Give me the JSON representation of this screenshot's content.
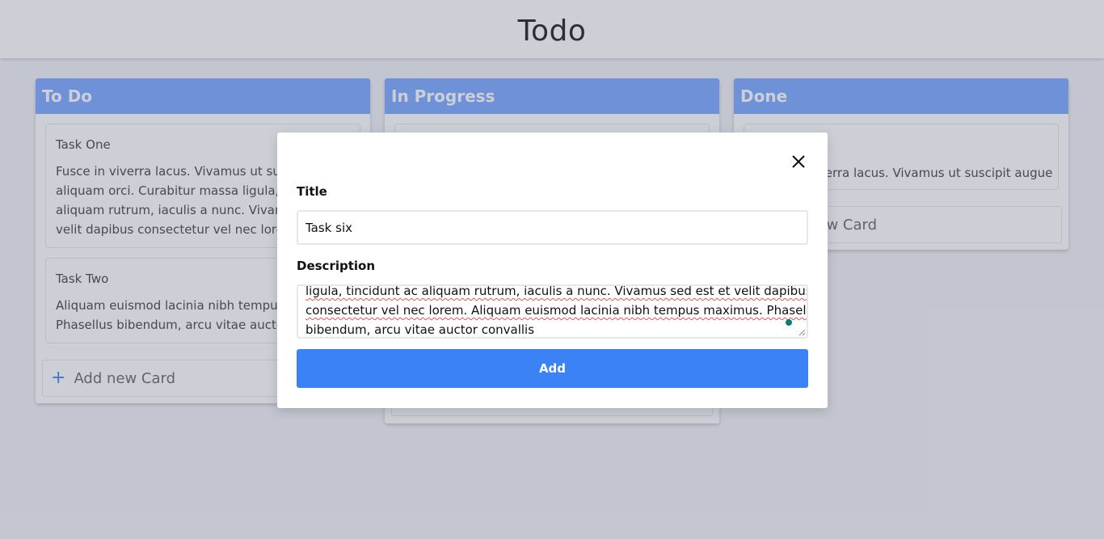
{
  "app": {
    "title": "Todo"
  },
  "columns": [
    {
      "title": "To Do",
      "cards": [
        {
          "title": "Task One",
          "lines": [
            "Fusce in viverra lacus. Vivamus ut suscipit augue",
            "aliquam orci. Curabitur massa ligula, tincidunt ac",
            "aliquam rutrum, iaculis a nunc. Vivamus sed est et",
            "velit dapibus consectetur vel nec lorem"
          ]
        },
        {
          "title": "Task Two",
          "lines": [
            "Aliquam euismod lacinia nibh tempus maximus.",
            "Phasellus bibendum, arcu vitae auctor convallis"
          ]
        }
      ],
      "add_label": "Add new Card"
    },
    {
      "title": "In Progress"
    },
    {
      "title": "Done",
      "cards": [
        {
          "lines": [
            "Fusce in viverra lacus. Vivamus ut suscipit augue"
          ]
        }
      ],
      "add_label": "Add new Card"
    }
  ],
  "modal": {
    "title_label": "Title",
    "title_value": "Task six",
    "description_label": "Description",
    "description_lines": [
      "ligula, tincidunt ac aliquam rutrum, iaculis a nunc. Vivamus sed est et velit dapibus",
      "consectetur vel nec lorem. Aliquam euismod lacinia nibh tempus maximus. Phasellus",
      "bibendum, arcu vitae auctor convallis"
    ],
    "add_button": "Add"
  },
  "icons": {
    "close": "close-icon",
    "plus": "plus-icon"
  },
  "colors": {
    "column_header": "#87b0ff",
    "primary_button": "#3b82f6"
  }
}
